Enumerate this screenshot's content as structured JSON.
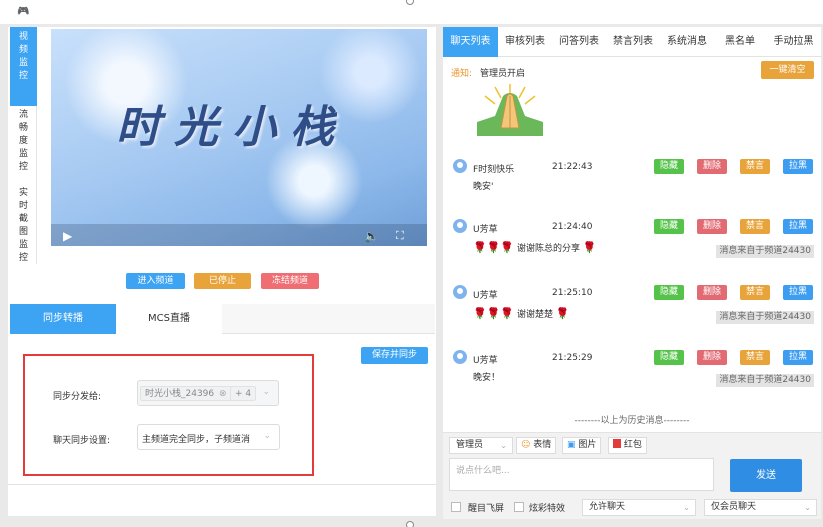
{
  "titlebar": {
    "icon": "gamepad-icon"
  },
  "left": {
    "vtabs": [
      {
        "label": "视频监控",
        "active": true
      },
      {
        "label": "流畅度监控",
        "active": false
      },
      {
        "label": "实时截图监控",
        "active": false
      }
    ],
    "video_logo": "时光小栈",
    "buttons": {
      "enter": "进入频道",
      "stopped": "已停止",
      "freeze": "冻结频道"
    },
    "tabs": [
      {
        "label": "同步转播",
        "active": true
      },
      {
        "label": "MCS直播",
        "active": false
      }
    ],
    "save_button": "保存并同步",
    "sync_to_label": "同步分发给:",
    "sync_to_tag": "时光小栈_24396",
    "sync_to_more": "+ 4",
    "chat_sync_label": "聊天同步设置:",
    "chat_sync_value": "主频道完全同步，子频道消"
  },
  "right": {
    "tabs": [
      "聊天列表",
      "审核列表",
      "问答列表",
      "禁言列表",
      "系统消息",
      "黑名单",
      "手动拉黑"
    ],
    "notice_label": "通知:",
    "notice_text": "管理员开启",
    "clear_button": "一键清空",
    "action_labels": {
      "hide": "隐藏",
      "delete": "删除",
      "mute": "禁言",
      "block": "拉黑"
    },
    "messages": [
      {
        "user": "F时刻快乐",
        "time": "21:22:43",
        "text": "晚安'",
        "roses_before": 0,
        "roses_after": 0,
        "source": ""
      },
      {
        "user": "U芳草",
        "time": "21:24:40",
        "text": "谢谢陈总的分享",
        "roses_before": 3,
        "roses_after": 1,
        "source": "消息来自于频道24430"
      },
      {
        "user": "U芳草",
        "time": "21:25:10",
        "text": "谢谢楚楚",
        "roses_before": 3,
        "roses_after": 1,
        "source": "消息来自于频道24430"
      },
      {
        "user": "U芳草",
        "time": "21:25:29",
        "text": "晚安！",
        "roses_before": 0,
        "roses_after": 0,
        "source": "消息来自于频道24430"
      }
    ],
    "history_text": "--------以上为历史消息--------",
    "input": {
      "role": "管理员",
      "emoji": "表情",
      "image": "图片",
      "redpacket": "红包",
      "placeholder": "说点什么吧...",
      "send": "发送",
      "flyscreen": "醒目飞屏",
      "effects": "炫彩特效",
      "allow_chat": "允许聊天",
      "member_chat": "仅会员聊天"
    }
  },
  "colors": {
    "primary": "#3da3f3",
    "green": "#55c24a",
    "red": "#e26b73",
    "orange": "#e8a43b",
    "blue": "#3d9df0",
    "send": "#2f8de4"
  }
}
